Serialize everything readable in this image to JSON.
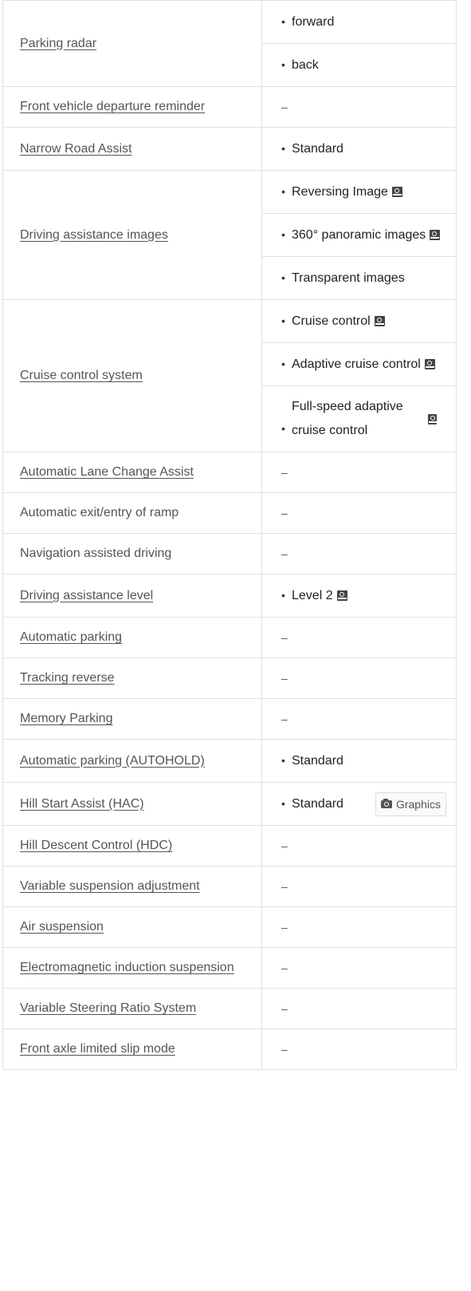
{
  "rows": [
    {
      "label": "Parking radar",
      "link": true,
      "options": [
        {
          "text": "forward"
        },
        {
          "text": "back"
        }
      ]
    },
    {
      "label": "Front vehicle departure reminder",
      "link": true,
      "value": "–"
    },
    {
      "label": "Narrow Road Assist",
      "link": true,
      "options": [
        {
          "text": "Standard"
        }
      ]
    },
    {
      "label": "Driving assistance images",
      "link": true,
      "options": [
        {
          "text": "Reversing Image",
          "icon": "image-preview-icon"
        },
        {
          "text": "360° panoramic images",
          "icon": "image-preview-icon"
        },
        {
          "text": "Transparent images"
        }
      ]
    },
    {
      "label": "Cruise control system",
      "link": true,
      "options": [
        {
          "text": "Cruise control",
          "icon": "image-preview-icon"
        },
        {
          "text": "Adaptive cruise control",
          "icon": "image-preview-icon"
        },
        {
          "text": "Full-speed adaptive cruise control",
          "icon": "image-preview-icon"
        }
      ]
    },
    {
      "label": "Automatic Lane Change Assist",
      "link": true,
      "value": "–"
    },
    {
      "label": "Automatic exit/entry of ramp",
      "link": false,
      "value": "–"
    },
    {
      "label": "Navigation assisted driving",
      "link": false,
      "value": "–"
    },
    {
      "label": "Driving assistance level",
      "link": true,
      "options": [
        {
          "text": "Level 2",
          "icon": "image-preview-icon"
        }
      ]
    },
    {
      "label": "Automatic parking",
      "link": true,
      "value": "–"
    },
    {
      "label": "Tracking reverse",
      "link": true,
      "value": "–"
    },
    {
      "label": "Memory Parking",
      "link": true,
      "value": "–"
    },
    {
      "label": "Automatic parking (AUTOHOLD)",
      "link": true,
      "options": [
        {
          "text": "Standard"
        }
      ]
    },
    {
      "label": "Hill Start Assist (HAC)",
      "link": true,
      "options": [
        {
          "text": "Standard",
          "button": "Graphics",
          "button_icon": "camera-icon"
        }
      ]
    },
    {
      "label": "Hill Descent Control (HDC)",
      "link": true,
      "value": "–"
    },
    {
      "label": "Variable suspension adjustment",
      "link": true,
      "value": "–"
    },
    {
      "label": "Air suspension",
      "link": true,
      "value": "–"
    },
    {
      "label": "Electromagnetic induction suspension",
      "link": true,
      "value": "–"
    },
    {
      "label": "Variable Steering Ratio System",
      "link": true,
      "value": "–"
    },
    {
      "label": "Front axle limited slip mode",
      "link": true,
      "value": "–"
    }
  ],
  "bullet": "•"
}
